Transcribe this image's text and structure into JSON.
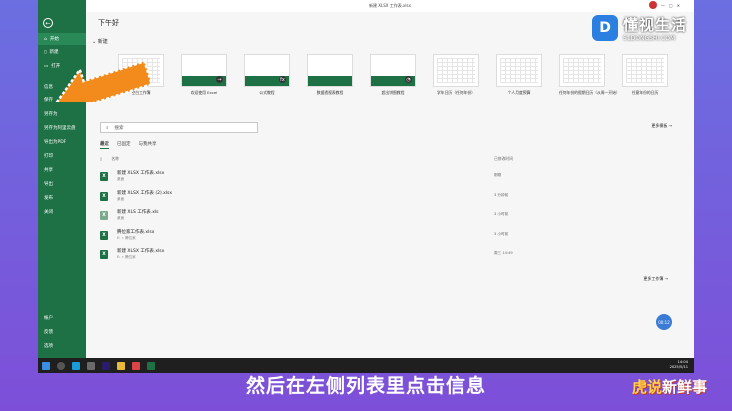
{
  "window": {
    "title": "新建 XLSX 工作表.xlsx"
  },
  "sidebar": {
    "back": "←",
    "items": [
      {
        "label": "开始",
        "icon": "home-icon"
      },
      {
        "label": "新建",
        "icon": "new-file-icon"
      },
      {
        "label": "打开",
        "icon": "folder-icon"
      },
      {
        "label": "信息"
      },
      {
        "label": "保存"
      },
      {
        "label": "另存为"
      },
      {
        "label": "另存为阿里云盘"
      },
      {
        "label": "导出为PDF"
      },
      {
        "label": "打印"
      },
      {
        "label": "共享"
      },
      {
        "label": "导出"
      },
      {
        "label": "发布"
      },
      {
        "label": "关闭"
      }
    ],
    "bottom": [
      {
        "label": "帐户"
      },
      {
        "label": "反馈"
      },
      {
        "label": "选项"
      }
    ]
  },
  "main": {
    "greeting": "下午好",
    "new_section": "新建",
    "templates": [
      {
        "label": "空白工作簿"
      },
      {
        "label": "欢迎使用 Excel"
      },
      {
        "label": "公式教程"
      },
      {
        "label": "数据透视表教程"
      },
      {
        "label": "超出饼图教程"
      },
      {
        "label": "学年日历（任何年份）"
      },
      {
        "label": "个人月度预算"
      },
      {
        "label": "任何年份的假期日历（从周一开始）"
      },
      {
        "label": "任意年份的日历"
      }
    ],
    "more_templates": "更多模板 →",
    "search_placeholder": "搜索",
    "tabs": [
      "最近",
      "已固定",
      "与我共享"
    ],
    "col_name": "名称",
    "col_date": "已修改时间",
    "files": [
      {
        "name": "新建 XLSX 工作表.xlsx",
        "path": "桌面",
        "date": "刚刚"
      },
      {
        "name": "新建 XLSX 工作表 (2).xlsx",
        "path": "桌面",
        "date": "3 分钟前"
      },
      {
        "name": "新建 XLS 工作表.xls",
        "path": "桌面",
        "date": "3 小时前"
      },
      {
        "name": "腾位家工作表.xlsx",
        "path": "E: » 腾位家",
        "date": "3 小时前"
      },
      {
        "name": "新建 XLSX 工作表.xlsx",
        "path": "E: » 腾位家",
        "date": "周三 14:49"
      }
    ],
    "more_workbooks": "更多工作簿 →",
    "fab_label": "00:12"
  },
  "taskbar": {
    "time": "14:04",
    "date": "2025/5/11"
  },
  "caption": "然后在左侧列表里点击信息",
  "watermark_top": {
    "logo": "D",
    "title": "懂视生活",
    "subtitle": "51DONGSHI.COM"
  },
  "watermark_bottom": {
    "a": "虎说",
    "b": "新鲜事"
  }
}
